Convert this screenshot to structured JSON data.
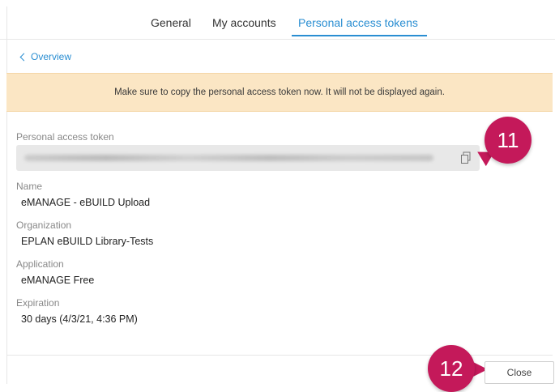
{
  "tabs": [
    {
      "label": "General"
    },
    {
      "label": "My accounts"
    },
    {
      "label": "Personal access tokens",
      "active": true
    }
  ],
  "overview_link": "Overview",
  "banner": {
    "text": "Make sure to copy the personal access token now. It will not be displayed again."
  },
  "fields": {
    "token_label": "Personal access token",
    "name_label": "Name",
    "name_value": "eMANAGE - eBUILD Upload",
    "org_label": "Organization",
    "org_value": "EPLAN eBUILD Library-Tests",
    "app_label": "Application",
    "app_value": "eMANAGE Free",
    "exp_label": "Expiration",
    "exp_value": "30 days (4/3/21, 4:36 PM)"
  },
  "callouts": {
    "copy": "11",
    "close": "12"
  },
  "close_button": "Close",
  "colors": {
    "accent": "#2a8ed2",
    "banner_bg": "#fbe6c4",
    "callout": "#c4195a"
  }
}
